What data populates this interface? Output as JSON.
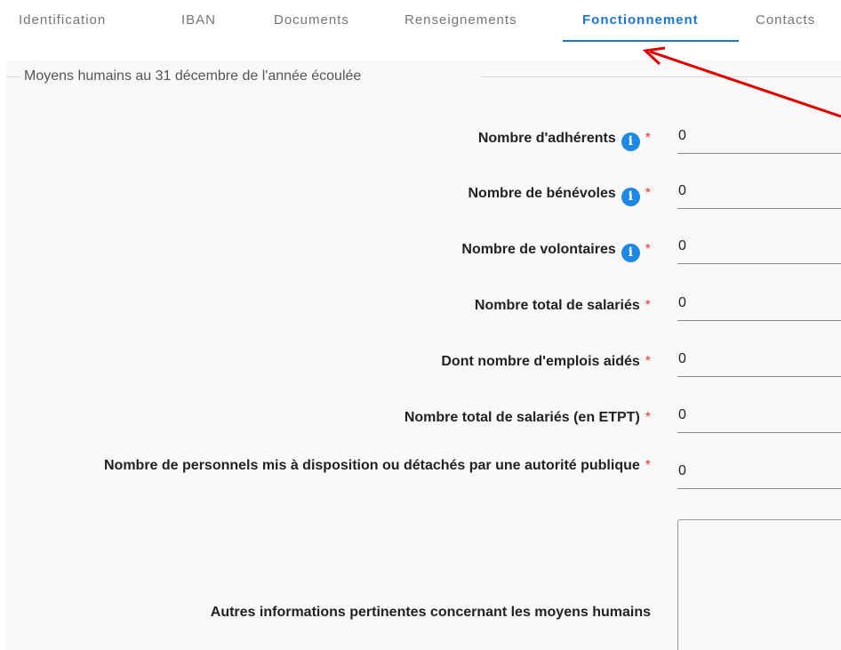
{
  "tabs": [
    {
      "label": "Identification",
      "active": false
    },
    {
      "label": "IBAN",
      "active": false
    },
    {
      "label": "Documents",
      "active": false
    },
    {
      "label": "Renseignements",
      "active": false
    },
    {
      "label": "Fonctionnement",
      "active": true
    },
    {
      "label": "Contacts",
      "active": false
    }
  ],
  "section": {
    "legend": "Moyens humains au 31 décembre de l'année écoulée"
  },
  "form": {
    "fields": [
      {
        "label": "Nombre d'adhérents",
        "has_info": true,
        "required_mark": "*",
        "value": "0"
      },
      {
        "label": "Nombre de bénévoles",
        "has_info": true,
        "required_mark": "*",
        "value": "0"
      },
      {
        "label": "Nombre de volontaires",
        "has_info": true,
        "required_mark": "*",
        "value": "0"
      },
      {
        "label": "Nombre total de salariés",
        "has_info": false,
        "required_mark": "*",
        "value": "0"
      },
      {
        "label": "Dont nombre d'emplois aidés",
        "has_info": false,
        "required_mark": "*",
        "value": "0"
      },
      {
        "label": "Nombre total de salariés (en ETPT)",
        "has_info": false,
        "required_mark": "*",
        "value": "0"
      },
      {
        "label": "Nombre de personnels mis à disposition ou détachés par une autorité publique",
        "has_info": false,
        "required_mark": "*",
        "value": "0"
      }
    ],
    "textarea": {
      "label": "Autres informations pertinentes concernant les moyens humains",
      "value": ""
    }
  },
  "icons": {
    "info": "info-icon",
    "info_glyph": "i"
  },
  "annotation": {
    "arrow_color": "#e30000"
  },
  "colors": {
    "accent": "#1976d2",
    "required": "#e53935",
    "info_icon": "#1e88e5"
  }
}
